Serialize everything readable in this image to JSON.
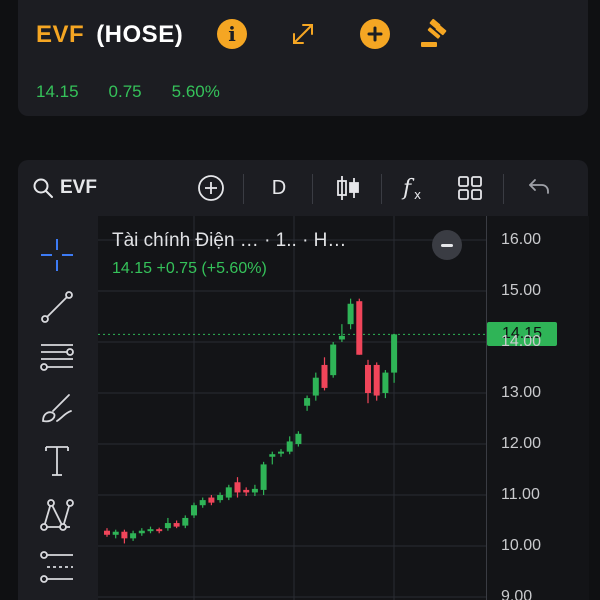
{
  "header": {
    "symbol": "EVF",
    "exchange": "(HOSE)",
    "price": "14.15",
    "change": "0.75",
    "change_pct": "5.60%",
    "accent_color": "#f5a623",
    "up_color": "#35c25a",
    "icons": [
      "info-icon",
      "expand-icon",
      "add-icon",
      "auction-hammer-icon"
    ]
  },
  "toolbar": {
    "search_label": "EVF",
    "interval": "D",
    "icons": [
      "search-icon",
      "add-comparison-icon",
      "candle-type-icon",
      "indicators-fx-icon",
      "layout-grid-icon",
      "undo-icon"
    ]
  },
  "left_tools": [
    "crosshair-icon",
    "trend-line-icon",
    "fib-lines-icon",
    "brush-icon",
    "text-tool-icon",
    "pattern-icon",
    "forecast-icon"
  ],
  "legend": {
    "title": "Tài chính Điện … · 1.. · H…",
    "price_line": "14.15  +0.75 (+5.60%)"
  },
  "price_axis": {
    "ticks": [
      "16.00",
      "15.00",
      "14.00",
      "13.00",
      "12.00",
      "11.00",
      "10.00",
      "9.00"
    ],
    "last_price": "14.15"
  },
  "chart_data": {
    "type": "candlestick",
    "up_color": "#2fb457",
    "down_color": "#f0455a",
    "ylim": [
      9.0,
      16.0
    ],
    "last_price": 14.15,
    "candles": [
      {
        "o": 10.3,
        "h": 10.35,
        "l": 10.18,
        "c": 10.22
      },
      {
        "o": 10.22,
        "h": 10.32,
        "l": 10.15,
        "c": 10.28
      },
      {
        "o": 10.28,
        "h": 10.32,
        "l": 10.05,
        "c": 10.15
      },
      {
        "o": 10.15,
        "h": 10.3,
        "l": 10.1,
        "c": 10.25
      },
      {
        "o": 10.25,
        "h": 10.35,
        "l": 10.2,
        "c": 10.3
      },
      {
        "o": 10.3,
        "h": 10.38,
        "l": 10.25,
        "c": 10.33
      },
      {
        "o": 10.33,
        "h": 10.36,
        "l": 10.25,
        "c": 10.3
      },
      {
        "o": 10.35,
        "h": 10.55,
        "l": 10.3,
        "c": 10.45
      },
      {
        "o": 10.45,
        "h": 10.5,
        "l": 10.35,
        "c": 10.38
      },
      {
        "o": 10.4,
        "h": 10.6,
        "l": 10.35,
        "c": 10.55
      },
      {
        "o": 10.6,
        "h": 10.85,
        "l": 10.55,
        "c": 10.8
      },
      {
        "o": 10.8,
        "h": 10.95,
        "l": 10.75,
        "c": 10.9
      },
      {
        "o": 10.95,
        "h": 11.0,
        "l": 10.8,
        "c": 10.85
      },
      {
        "o": 10.9,
        "h": 11.05,
        "l": 10.85,
        "c": 11.0
      },
      {
        "o": 10.95,
        "h": 11.2,
        "l": 10.9,
        "c": 11.15
      },
      {
        "o": 11.25,
        "h": 11.35,
        "l": 10.95,
        "c": 11.05
      },
      {
        "o": 11.1,
        "h": 11.15,
        "l": 10.98,
        "c": 11.05
      },
      {
        "o": 11.05,
        "h": 11.2,
        "l": 10.98,
        "c": 11.12
      },
      {
        "o": 11.1,
        "h": 11.65,
        "l": 11.0,
        "c": 11.6
      },
      {
        "o": 11.75,
        "h": 11.85,
        "l": 11.6,
        "c": 11.8
      },
      {
        "o": 11.82,
        "h": 11.9,
        "l": 11.75,
        "c": 11.85
      },
      {
        "o": 11.85,
        "h": 12.15,
        "l": 11.8,
        "c": 12.05
      },
      {
        "o": 12.0,
        "h": 12.25,
        "l": 11.95,
        "c": 12.2
      },
      {
        "o": 12.75,
        "h": 12.95,
        "l": 12.65,
        "c": 12.9
      },
      {
        "o": 12.95,
        "h": 13.4,
        "l": 12.85,
        "c": 13.3
      },
      {
        "o": 13.55,
        "h": 13.7,
        "l": 13.05,
        "c": 13.1
      },
      {
        "o": 13.35,
        "h": 14.0,
        "l": 13.3,
        "c": 13.95
      },
      {
        "o": 14.05,
        "h": 14.35,
        "l": 14.0,
        "c": 14.12
      },
      {
        "o": 14.35,
        "h": 14.85,
        "l": 14.25,
        "c": 14.75
      },
      {
        "o": 14.8,
        "h": 14.85,
        "l": 13.75,
        "c": 13.75
      },
      {
        "o": 13.55,
        "h": 13.65,
        "l": 12.8,
        "c": 13.0
      },
      {
        "o": 13.55,
        "h": 13.6,
        "l": 12.85,
        "c": 12.95
      },
      {
        "o": 13.0,
        "h": 13.45,
        "l": 12.9,
        "c": 13.4
      },
      {
        "o": 13.4,
        "h": 14.15,
        "l": 13.2,
        "c": 14.15
      }
    ]
  }
}
